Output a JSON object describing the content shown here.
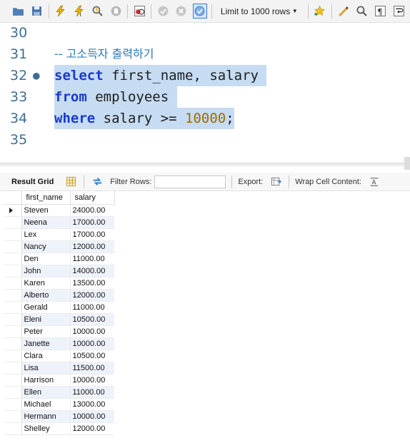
{
  "toolbar": {
    "limit_label": "Limit to 1000 rows"
  },
  "editor": {
    "lines": [
      {
        "num": "30",
        "text": ""
      },
      {
        "num": "31",
        "comment": "-- 고소득자 출력하기"
      },
      {
        "num": "32",
        "kw": "select",
        "rest": " first_name, salary"
      },
      {
        "num": "33",
        "kw": "from",
        "rest": " employees"
      },
      {
        "num": "34",
        "kw": "where",
        "rest": " salary >= ",
        "number": "10000",
        "tail": ";"
      },
      {
        "num": "35",
        "text": ""
      }
    ]
  },
  "result_toolbar": {
    "tab_label": "Result Grid",
    "filter_label": "Filter Rows:",
    "export_label": "Export:",
    "wrap_label": "Wrap Cell Content:"
  },
  "grid": {
    "columns": [
      "first_name",
      "salary"
    ],
    "rows": [
      [
        "Steven",
        "24000.00"
      ],
      [
        "Neena",
        "17000.00"
      ],
      [
        "Lex",
        "17000.00"
      ],
      [
        "Nancy",
        "12000.00"
      ],
      [
        "Den",
        "11000.00"
      ],
      [
        "John",
        "14000.00"
      ],
      [
        "Karen",
        "13500.00"
      ],
      [
        "Alberto",
        "12000.00"
      ],
      [
        "Gerald",
        "11000.00"
      ],
      [
        "Eleni",
        "10500.00"
      ],
      [
        "Peter",
        "10000.00"
      ],
      [
        "Janette",
        "10000.00"
      ],
      [
        "Clara",
        "10500.00"
      ],
      [
        "Lisa",
        "11500.00"
      ],
      [
        "Harrison",
        "10000.00"
      ],
      [
        "Ellen",
        "11000.00"
      ],
      [
        "Michael",
        "13000.00"
      ],
      [
        "Hermann",
        "10000.00"
      ],
      [
        "Shelley",
        "12000.00"
      ]
    ]
  }
}
